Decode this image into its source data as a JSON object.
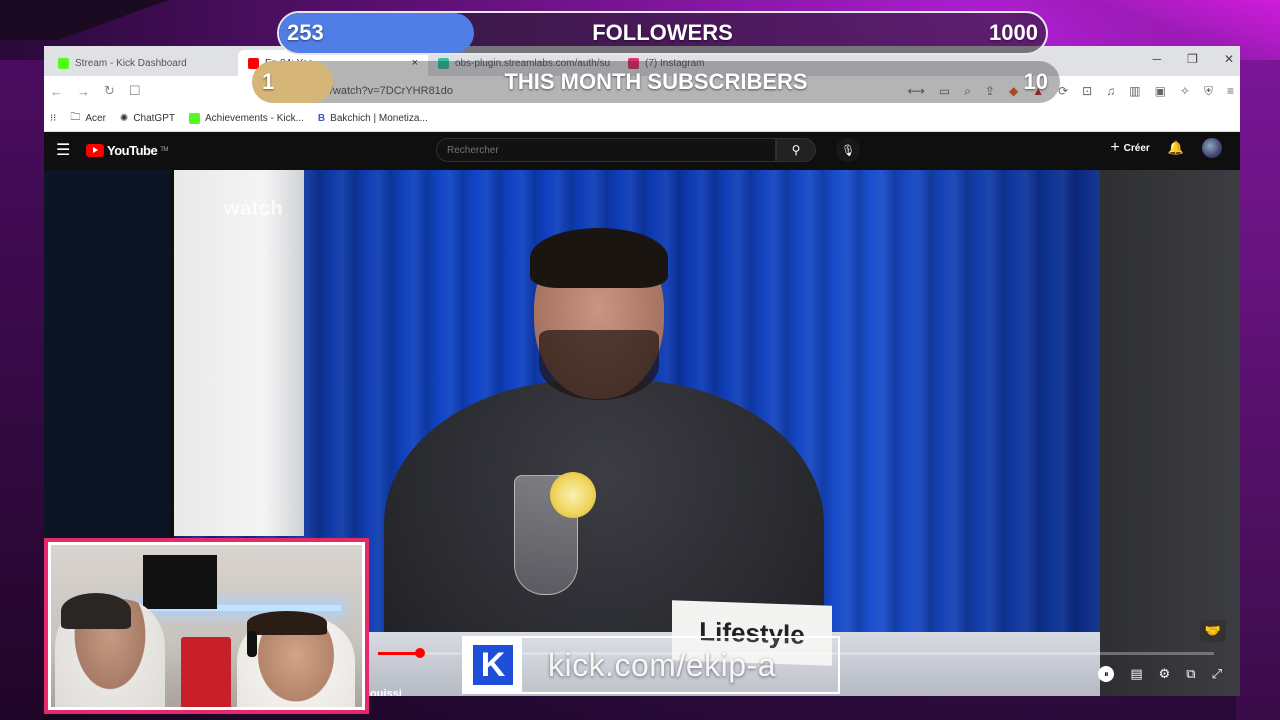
{
  "overlay": {
    "followers": {
      "current": "253",
      "title": "FOLLOWERS",
      "goal": "1000",
      "progress": 0.253,
      "fill_color": "#4f7fe6"
    },
    "subscribers": {
      "current": "1",
      "title": "THIS MONTH SUBSCRIBERS",
      "goal": "10",
      "progress": 0.1,
      "fill_color": "#d6b678"
    },
    "kick_banner": {
      "logo_letter": "K",
      "text": "kick.com/ekip-a"
    }
  },
  "browser": {
    "tabs": [
      {
        "label": "Stream - Kick Dashboard",
        "icon": "kick-icon",
        "color": "#53fc18",
        "active": false
      },
      {
        "label": "Ep 84: Yas",
        "icon": "youtube-icon",
        "color": "#ff0000",
        "active": true
      },
      {
        "label": "obs-plugin.streamlabs.com/auth/su",
        "icon": "streamlabs-icon",
        "color": "#31c3a2",
        "active": false
      },
      {
        "label": "(7) Instagram",
        "icon": "instagram-icon",
        "color": "#e1306c",
        "active": false
      }
    ],
    "close_tab": "×",
    "url": "om/watch?v=7DCrYHR81do",
    "bookmarks": [
      {
        "label": "Acer",
        "icon": "folder-icon",
        "color": "#444"
      },
      {
        "label": "ChatGPT",
        "icon": "chatgpt-icon",
        "color": "#333"
      },
      {
        "label": "Achievements - Kick...",
        "icon": "kick-icon",
        "color": "#53fc18"
      },
      {
        "label": "Bakchich | Monetiza...",
        "icon": "bakchich-icon",
        "color": "#3b5bdb"
      }
    ]
  },
  "youtube": {
    "logo": "YouTube",
    "logo_tm": "TM",
    "search_placeholder": "Rechercher",
    "create_label": "Créer",
    "video": {
      "watermark": "watch",
      "name_card": "Lifestyle",
      "channel": "ouissi",
      "progress": 0.05
    }
  }
}
